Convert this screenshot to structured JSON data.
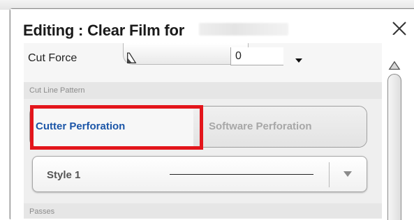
{
  "window": {
    "title": "Editing : Clear Film for",
    "close_icon": "close-icon"
  },
  "cut_force": {
    "label": "Cut Force",
    "value": "0"
  },
  "cut_line_pattern": {
    "section_label": "Cut Line Pattern",
    "options": [
      "Cutter Perforation",
      "Software Perforation"
    ],
    "selected": "Cutter Perforation"
  },
  "style": {
    "selected": "Style 1"
  },
  "passes": {
    "section_label": "Passes"
  },
  "colors": {
    "highlight": "#e3151b",
    "selected_text": "#1c56a8",
    "disabled_text": "#a7a7a7"
  }
}
